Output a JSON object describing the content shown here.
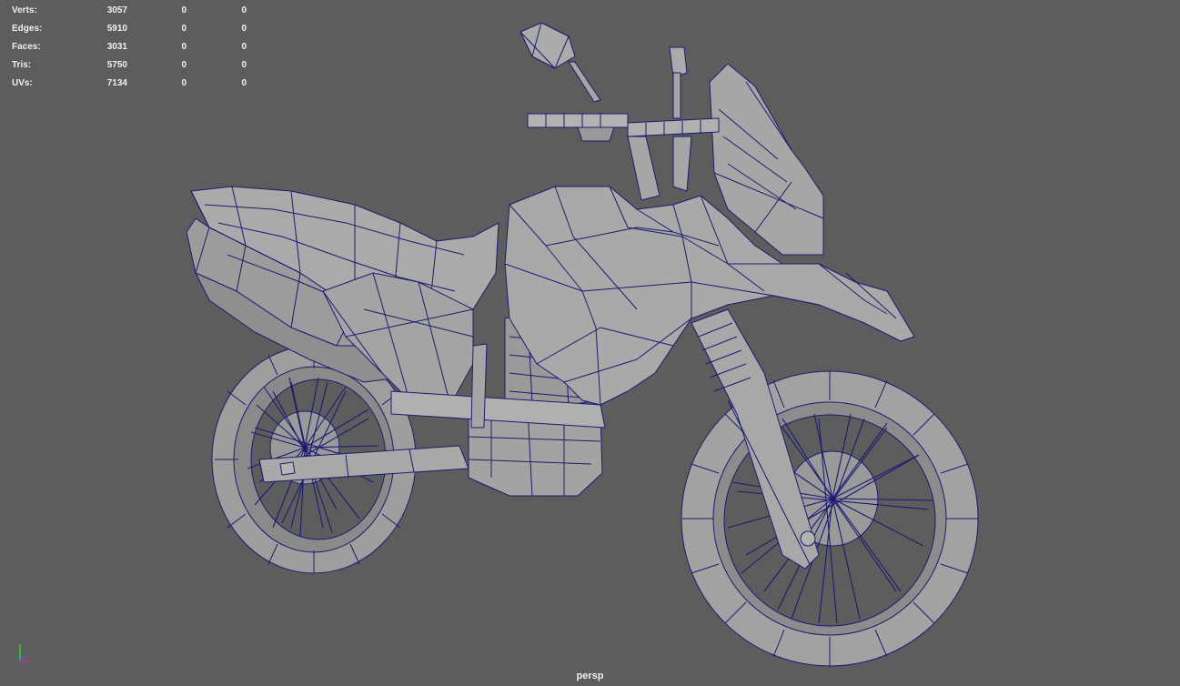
{
  "hud": {
    "rows": [
      {
        "label": "Verts:",
        "total": "3057",
        "sel1": "0",
        "sel2": "0"
      },
      {
        "label": "Edges:",
        "total": "5910",
        "sel1": "0",
        "sel2": "0"
      },
      {
        "label": "Faces:",
        "total": "3031",
        "sel1": "0",
        "sel2": "0"
      },
      {
        "label": "Tris:",
        "total": "5750",
        "sel1": "0",
        "sel2": "0"
      },
      {
        "label": "UVs:",
        "total": "7134",
        "sel1": "0",
        "sel2": "0"
      }
    ]
  },
  "viewport": {
    "camera_label": "persp",
    "background": "#5d5d5d",
    "wire_color": "#1a1a6e",
    "shade_color": "#a8a8a8"
  },
  "axis": {
    "x_color": "#e03030",
    "y_color": "#30d030",
    "z_color": "#3060ff",
    "x_label": "x",
    "z_label": "z"
  }
}
